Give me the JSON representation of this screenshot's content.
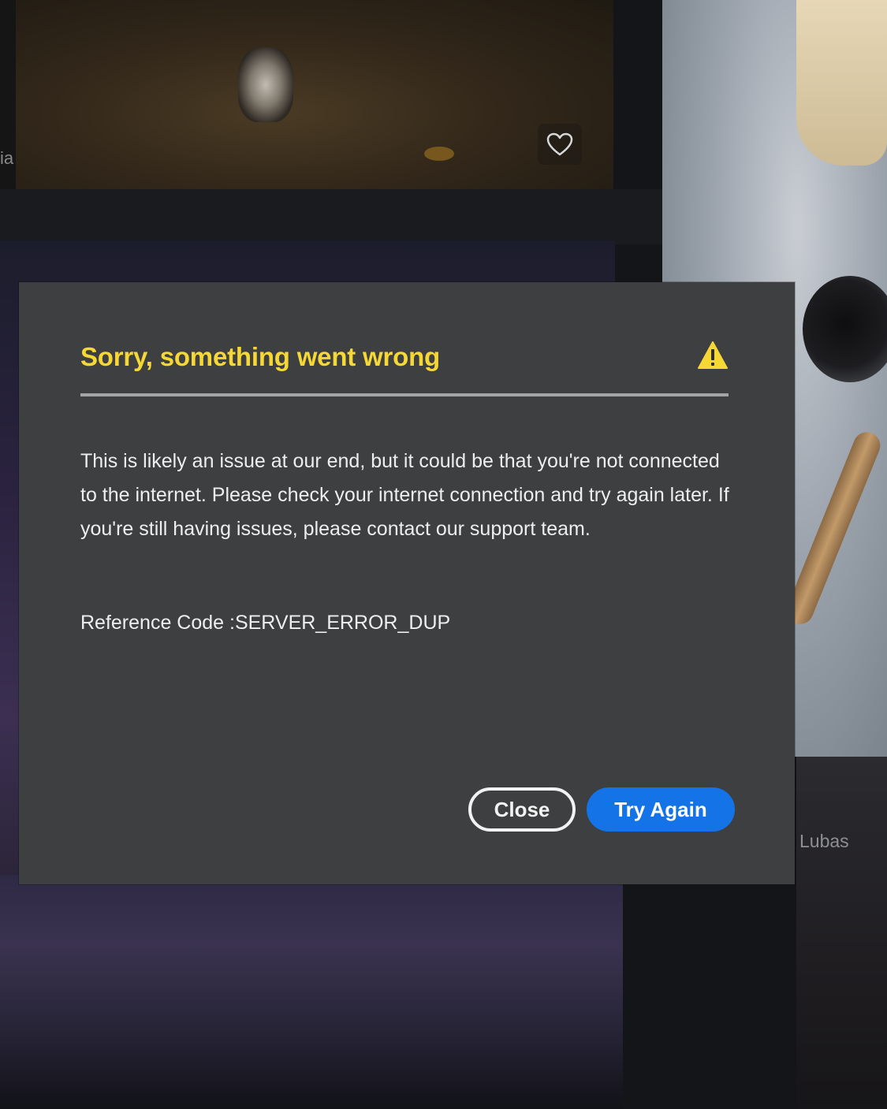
{
  "background": {
    "left_edge_label": "ia",
    "author_label": "Lubas"
  },
  "dialog": {
    "title": "Sorry, something went wrong",
    "body": "This is likely an issue at our end, but it could be that you're not connected to the internet. Please check your internet connection and try again later. If you're still having issues, please contact our support team.",
    "reference": "Reference Code :SERVER_ERROR_DUP",
    "close_label": "Close",
    "try_again_label": "Try Again",
    "icon": "warning-icon"
  },
  "colors": {
    "title": "#f5d735",
    "primary_button": "#1473e6",
    "dialog_background": "#3d3f40"
  }
}
